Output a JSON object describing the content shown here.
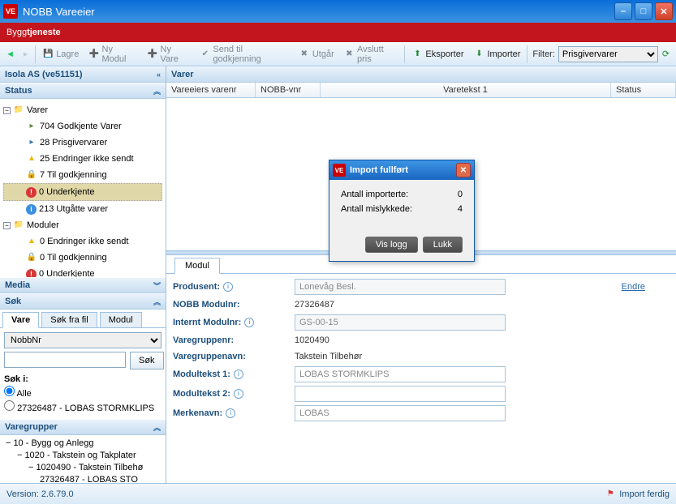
{
  "window": {
    "title": "NOBB Vareeier"
  },
  "brand": {
    "left": "Bygg",
    "right": "tjeneste"
  },
  "toolbar": {
    "lagre": "Lagre",
    "ny_modul": "Ny Modul",
    "ny_vare": "Ny Vare",
    "send": "Send til godkjenning",
    "utgar": "Utgår",
    "avslutt": "Avslutt pris",
    "eksporter": "Eksporter",
    "importer": "Importer",
    "filter_label": "Filter:",
    "filter_value": "Prisgivervarer"
  },
  "supplier": "Isola AS (ve51151)",
  "status": {
    "header": "Status",
    "varer": {
      "label": "Varer",
      "items": [
        {
          "text": "704 Godkjente Varer",
          "icon": "flag-green"
        },
        {
          "text": "28 Prisgivervarer",
          "icon": "flag-blue"
        },
        {
          "text": "25 Endringer ikke sendt",
          "icon": "warn"
        },
        {
          "text": "7 Til godkjenning",
          "icon": "lock"
        },
        {
          "text": "0 Underkjente",
          "icon": "err",
          "selected": true
        },
        {
          "text": "213 Utgåtte varer",
          "icon": "info"
        }
      ]
    },
    "moduler": {
      "label": "Moduler",
      "items": [
        {
          "text": "0 Endringer ikke sendt",
          "icon": "warn"
        },
        {
          "text": "0 Til godkjenning",
          "icon": "lock"
        },
        {
          "text": "0 Underkjente",
          "icon": "err"
        }
      ]
    }
  },
  "media_header": "Media",
  "sok": {
    "header": "Søk",
    "tabs": {
      "vare": "Vare",
      "fil": "Søk fra fil",
      "modul": "Modul"
    },
    "field": "NobbNr",
    "button": "Søk",
    "sok_i": "Søk i:",
    "alle": "Alle",
    "item": "27326487 - LOBAS STORMKLIPS"
  },
  "varegrupper": {
    "header": "Varegrupper",
    "items": [
      "10 - Bygg og Anlegg",
      "1020 - Takstein og Takplater",
      "1020490 - Takstein Tilbehø",
      "27326487 - LOBAS STO"
    ]
  },
  "grid": {
    "title": "Varer",
    "cols": {
      "c1": "Vareeiers varenr",
      "c2": "NOBB-vnr",
      "c3": "Varetekst 1",
      "c4": "Status"
    }
  },
  "modul": {
    "tab": "Modul",
    "produsent": {
      "label": "Produsent:",
      "value": "Lonevåg Besl.",
      "endre": "Endre"
    },
    "nobb_modulnr": {
      "label": "NOBB Modulnr:",
      "value": "27326487"
    },
    "internt_modulnr": {
      "label": "Internt Modulnr:",
      "value": "GS-00-15"
    },
    "varegruppe_nr": {
      "label": "Varegruppenr:",
      "value": "1020490"
    },
    "varegruppe_navn": {
      "label": "Varegruppenavn:",
      "value": "Takstein Tilbehør"
    },
    "modultekst1": {
      "label": "Modultekst 1:",
      "value": "LOBAS STORMKLIPS"
    },
    "modultekst2": {
      "label": "Modultekst 2:",
      "value": ""
    },
    "merkenavn": {
      "label": "Merkenavn:",
      "value": "LOBAS"
    }
  },
  "dialog": {
    "title": "Import fullført",
    "imported_label": "Antall importerte:",
    "imported_value": "0",
    "failed_label": "Antall mislykkede:",
    "failed_value": "4",
    "vis_logg": "Vis logg",
    "lukk": "Lukk"
  },
  "statusbar": {
    "version_label": "Version:",
    "version": "2.6.79.0",
    "import": "Import ferdig"
  }
}
